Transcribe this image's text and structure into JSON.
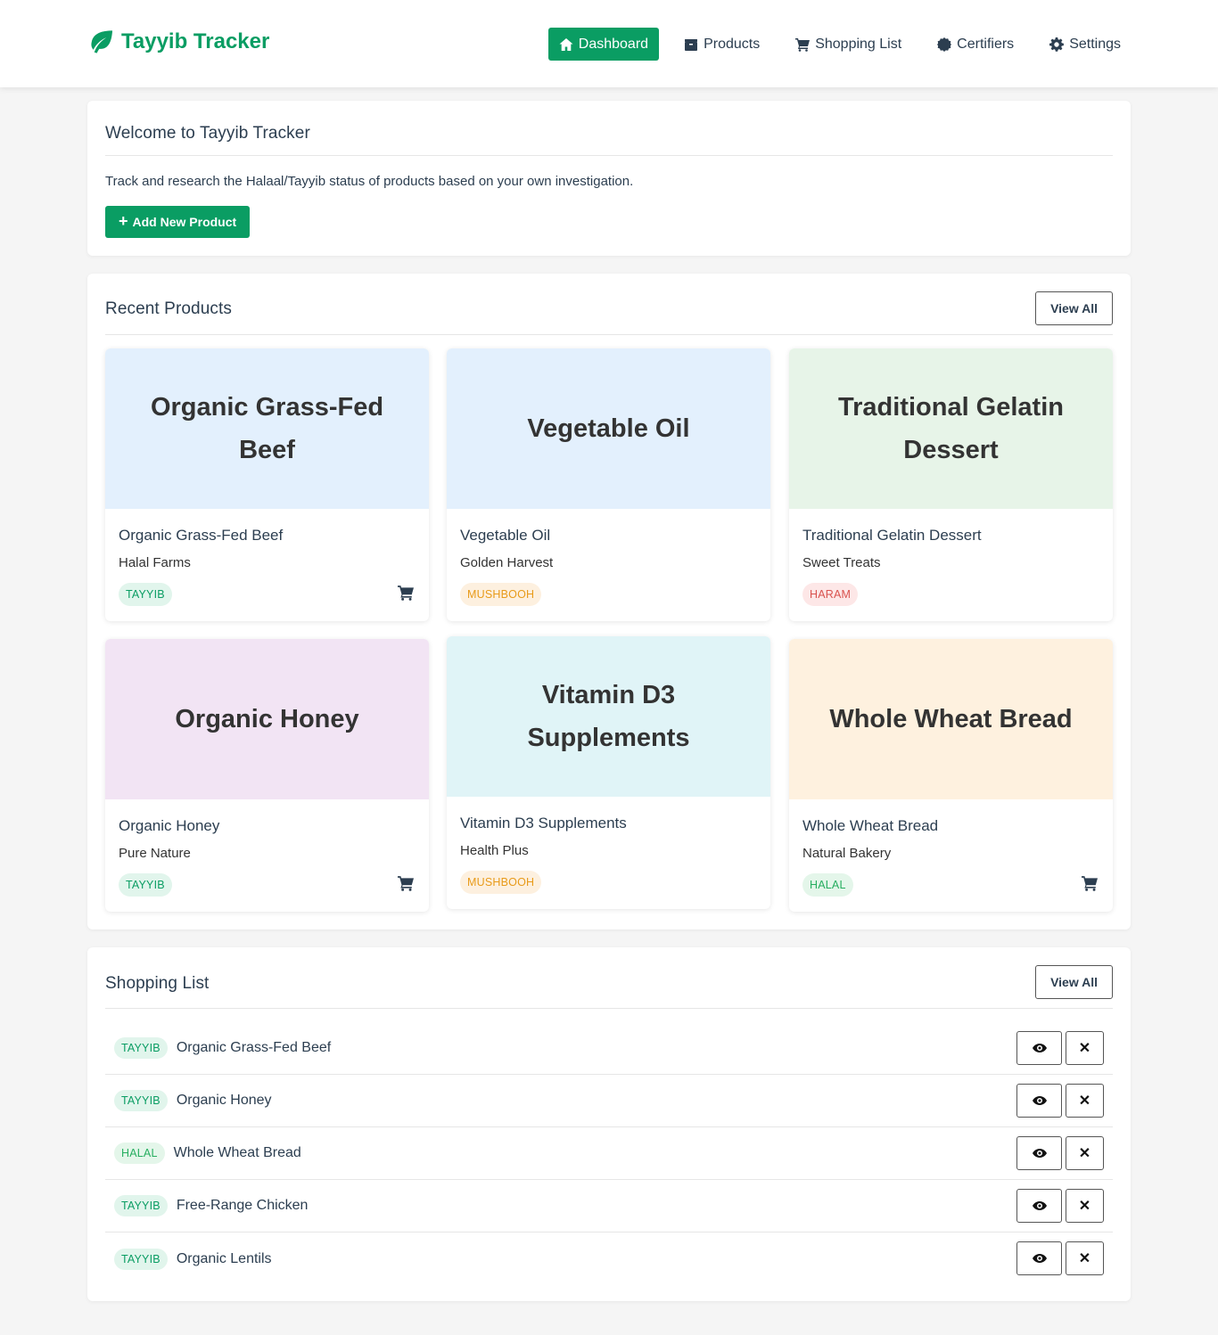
{
  "app": {
    "name": "Tayyib Tracker",
    "brand_color": "#0a9d63"
  },
  "nav": [
    {
      "label": "Dashboard",
      "icon": "home-icon",
      "active": true
    },
    {
      "label": "Products",
      "icon": "box-icon",
      "active": false
    },
    {
      "label": "Shopping List",
      "icon": "cart-icon",
      "active": false
    },
    {
      "label": "Certifiers",
      "icon": "certificate-icon",
      "active": false
    },
    {
      "label": "Settings",
      "icon": "gear-icon",
      "active": false
    }
  ],
  "welcome": {
    "title": "Welcome to Tayyib Tracker",
    "description": "Track and research the Halaal/Tayyib status of products based on your own investigation.",
    "add_button": "Add New Product"
  },
  "recent": {
    "title": "Recent Products",
    "view_all": "View All",
    "products": [
      {
        "image_text": "Organic Grass-Fed Beef",
        "name": "Organic Grass-Fed Beef",
        "brand": "Halal Farms",
        "status": "TAYYIB",
        "status_key": "tayyib",
        "image_bg": "#e3f0fd",
        "in_cart_icon": true
      },
      {
        "image_text": "Vegetable Oil",
        "name": "Vegetable Oil",
        "brand": "Golden Harvest",
        "status": "MUSHBOOH",
        "status_key": "mushbooh",
        "image_bg": "#e3f0fd",
        "in_cart_icon": false
      },
      {
        "image_text": "Traditional Gelatin Dessert",
        "name": "Traditional Gelatin Dessert",
        "brand": "Sweet Treats",
        "status": "HARAM",
        "status_key": "haram",
        "image_bg": "#e7f4e8",
        "in_cart_icon": false
      },
      {
        "image_text": "Organic Honey",
        "name": "Organic Honey",
        "brand": "Pure Nature",
        "status": "TAYYIB",
        "status_key": "tayyib",
        "image_bg": "#f2e4f4",
        "in_cart_icon": true
      },
      {
        "image_text": "Vitamin D3 Supplements",
        "name": "Vitamin D3 Supplements",
        "brand": "Health Plus",
        "status": "MUSHBOOH",
        "status_key": "mushbooh",
        "image_bg": "#e0f4f7",
        "in_cart_icon": false
      },
      {
        "image_text": "Whole Wheat Bread",
        "name": "Whole Wheat Bread",
        "brand": "Natural Bakery",
        "status": "HALAL",
        "status_key": "halal",
        "image_bg": "#fef1df",
        "in_cart_icon": true
      }
    ]
  },
  "shopping": {
    "title": "Shopping List",
    "view_all": "View All",
    "items": [
      {
        "status": "TAYYIB",
        "status_key": "tayyib",
        "name": "Organic Grass-Fed Beef"
      },
      {
        "status": "TAYYIB",
        "status_key": "tayyib",
        "name": "Organic Honey"
      },
      {
        "status": "HALAL",
        "status_key": "halal",
        "name": "Whole Wheat Bread"
      },
      {
        "status": "TAYYIB",
        "status_key": "tayyib",
        "name": "Free-Range Chicken"
      },
      {
        "status": "TAYYIB",
        "status_key": "tayyib",
        "name": "Organic Lentils"
      }
    ],
    "remove_glyph": "✕"
  }
}
